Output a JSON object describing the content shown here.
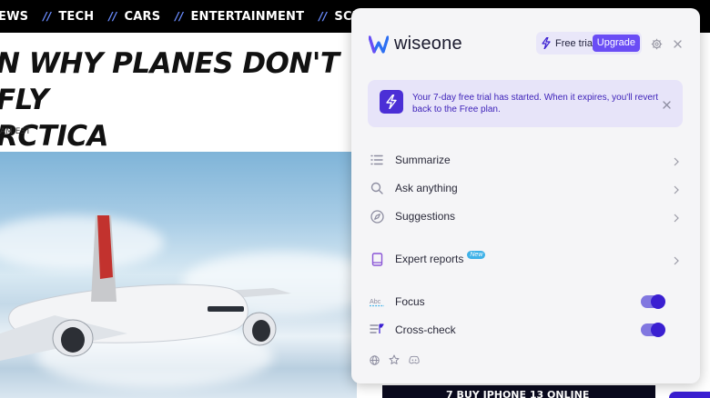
{
  "nav": {
    "items": [
      {
        "label": "EWS"
      },
      {
        "label": "TECH"
      },
      {
        "label": "CARS"
      },
      {
        "label": "ENTERTAINMENT"
      },
      {
        "label": "SCIENCE"
      }
    ],
    "separator": "//"
  },
  "article": {
    "headline_line1": "N WHY PLANES DON'T FLY",
    "headline_line2": "RCTICA",
    "byline": "AM EST"
  },
  "promo": {
    "text": "7  BUY IPHONE 13 ONLINE"
  },
  "panel": {
    "brand": "wiseone",
    "trial_label": "Free trial",
    "upgrade_label": "Upgrade",
    "notice_text": "Your 7-day free trial has started. When it expires, you'll revert back to the Free plan.",
    "menu": [
      {
        "label": "Summarize",
        "icon": "list-icon"
      },
      {
        "label": "Ask anything",
        "icon": "search-icon"
      },
      {
        "label": "Suggestions",
        "icon": "compass-icon"
      },
      {
        "label": "Expert reports",
        "icon": "book-icon",
        "badge": "New"
      }
    ],
    "toggles": [
      {
        "label": "Focus",
        "icon": "abc-focus-icon",
        "on": true
      },
      {
        "label": "Cross-check",
        "icon": "cross-check-icon",
        "on": true
      }
    ],
    "footer_icons": [
      "globe-icon",
      "star-icon",
      "discord-icon"
    ]
  },
  "colors": {
    "accent": "#3a1fd1",
    "upgrade": "#6a4df5",
    "notice_bg": "#e7e4f9",
    "brand_blue": "#2d6ff2"
  }
}
